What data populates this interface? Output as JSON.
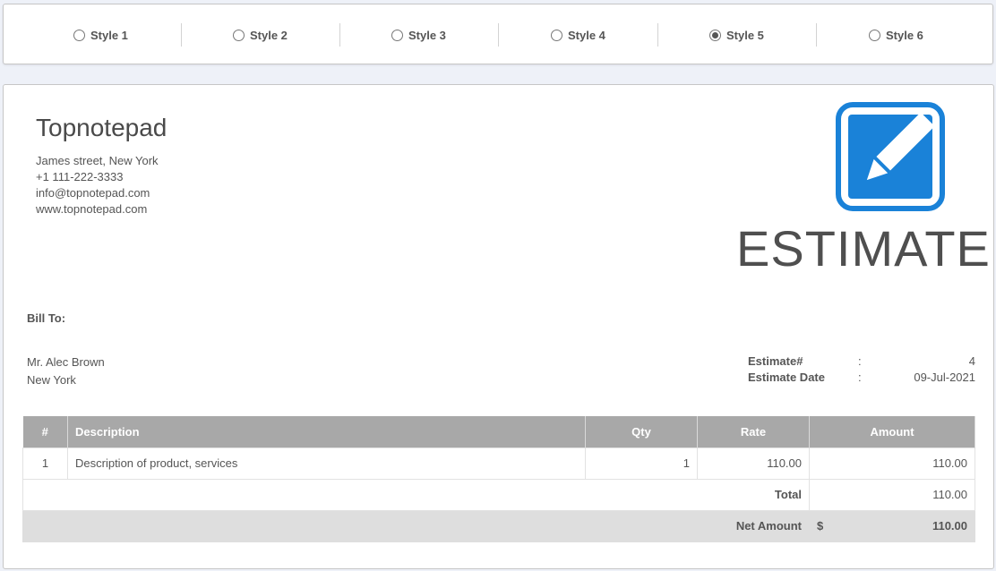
{
  "style_options": [
    {
      "label": "Style 1",
      "checked": false
    },
    {
      "label": "Style 2",
      "checked": false
    },
    {
      "label": "Style 3",
      "checked": false
    },
    {
      "label": "Style 4",
      "checked": false
    },
    {
      "label": "Style 5",
      "checked": true
    },
    {
      "label": "Style 6",
      "checked": false
    }
  ],
  "company": {
    "name": "Topnotepad",
    "address": "James street, New York",
    "phone": "+1 111-222-3333",
    "email": "info@topnotepad.com",
    "website": "www.topnotepad.com"
  },
  "logo": {
    "icon": "edit-pencil-icon",
    "color": "#1a82d8"
  },
  "document_title": "ESTIMATE",
  "bill_to": {
    "label": "Bill To:",
    "name": "Mr. Alec Brown",
    "city": "New York"
  },
  "meta": {
    "estimate_no_label": "Estimate#",
    "estimate_no": "4",
    "date_label": "Estimate Date",
    "date": "09-Jul-2021",
    "colon": ":"
  },
  "table": {
    "headers": {
      "num": "#",
      "desc": "Description",
      "qty": "Qty",
      "rate": "Rate",
      "amount": "Amount"
    },
    "rows": [
      {
        "num": "1",
        "desc": "Description of product, services",
        "qty": "1",
        "rate": "110.00",
        "amount": "110.00"
      }
    ],
    "total_label": "Total",
    "total": "110.00",
    "net_label": "Net Amount",
    "currency": "$",
    "net": "110.00"
  },
  "colors": {
    "header_bg": "#a8a8a8",
    "net_bg": "#dedede",
    "accent": "#1a82d8"
  }
}
